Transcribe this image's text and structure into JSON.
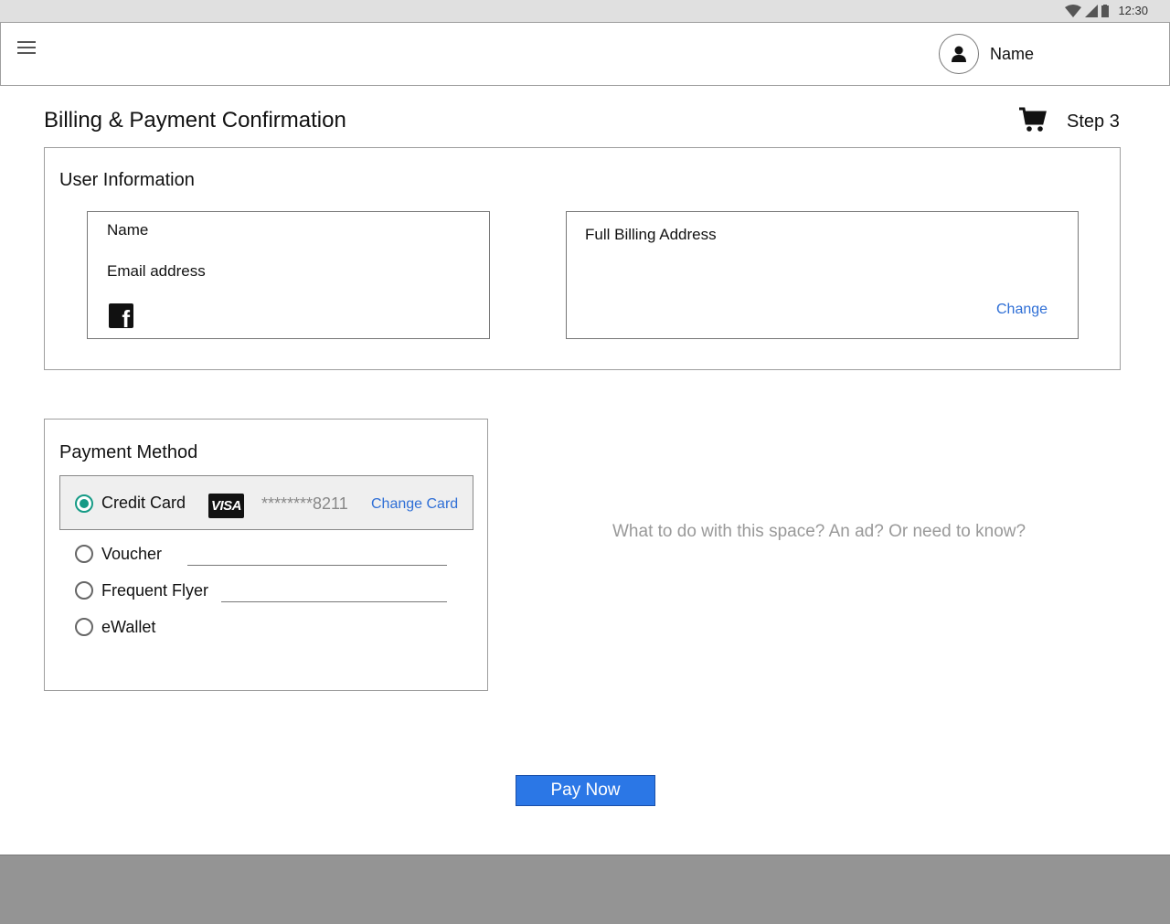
{
  "status_bar": {
    "time": "12:30"
  },
  "header": {
    "user_name": "Name"
  },
  "page": {
    "title": "Billing & Payment Confirmation",
    "step": "Step 3"
  },
  "user_info": {
    "heading": "User Information",
    "name": "Name",
    "email": "Email address",
    "address_title": "Full Billing Address",
    "change_label": "Change"
  },
  "payment": {
    "heading": "Payment Method",
    "credit_card_label": "Credit Card",
    "card_brand": "VISA",
    "masked_number": "********8211",
    "change_card_label": "Change Card",
    "voucher_label": "Voucher",
    "frequent_flyer_label": "Frequent Flyer",
    "ewallet_label": "eWallet",
    "selected": "credit_card"
  },
  "ad_space": {
    "text": "What to do with this space? An ad? Or need to know?"
  },
  "actions": {
    "pay_now_label": "Pay Now"
  },
  "colors": {
    "accent_blue": "#2b77e6",
    "radio_selected": "#169b86",
    "link_blue": "#2f6fd6",
    "footer_gray": "#949494"
  }
}
